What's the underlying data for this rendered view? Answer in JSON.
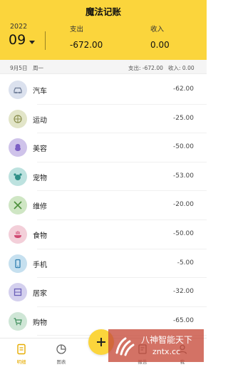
{
  "app": {
    "title": "魔法记账"
  },
  "header": {
    "year": "2022",
    "month": "09",
    "expense_label": "支出",
    "expense_value": "-672.00",
    "income_label": "收入",
    "income_value": "0.00",
    "background_color": "#fbd53c"
  },
  "day": {
    "date": "9月5日",
    "weekday": "周一",
    "expense": "支出: -672.00",
    "income": "收入: 0.00"
  },
  "entries": [
    {
      "label": "汽车",
      "amount": "-62.00",
      "icon": "car-icon",
      "color": "#dbe1ee"
    },
    {
      "label": "运动",
      "amount": "-25.00",
      "icon": "sport-icon",
      "color": "#e2e5c8"
    },
    {
      "label": "美容",
      "amount": "-50.00",
      "icon": "beauty-icon",
      "color": "#cfc3ea"
    },
    {
      "label": "宠物",
      "amount": "-53.00",
      "icon": "pet-icon",
      "color": "#bde2df"
    },
    {
      "label": "维修",
      "amount": "-20.00",
      "icon": "repair-icon",
      "color": "#cfe6c4"
    },
    {
      "label": "食物",
      "amount": "-50.00",
      "icon": "food-icon",
      "color": "#f3cfd9"
    },
    {
      "label": "手机",
      "amount": "-5.00",
      "icon": "phone-icon",
      "color": "#c6e0ef"
    },
    {
      "label": "居家",
      "amount": "-32.00",
      "icon": "home-icon",
      "color": "#d4d0ee"
    },
    {
      "label": "购物",
      "amount": "-65.00",
      "icon": "shopping-icon",
      "color": "#cfe6d6"
    }
  ],
  "nav": {
    "items": [
      {
        "label": "明细",
        "icon": "ledger-icon",
        "active": true
      },
      {
        "label": "图表",
        "icon": "chart-icon",
        "active": false
      },
      {
        "label": "报告",
        "icon": "report-icon",
        "active": false
      },
      {
        "label": "我",
        "icon": "user-icon",
        "active": false
      }
    ],
    "add_icon": "plus-icon",
    "active_color": "#e6ac00"
  },
  "watermark": {
    "text": "八神智能天下",
    "site": "zntx.cc"
  }
}
